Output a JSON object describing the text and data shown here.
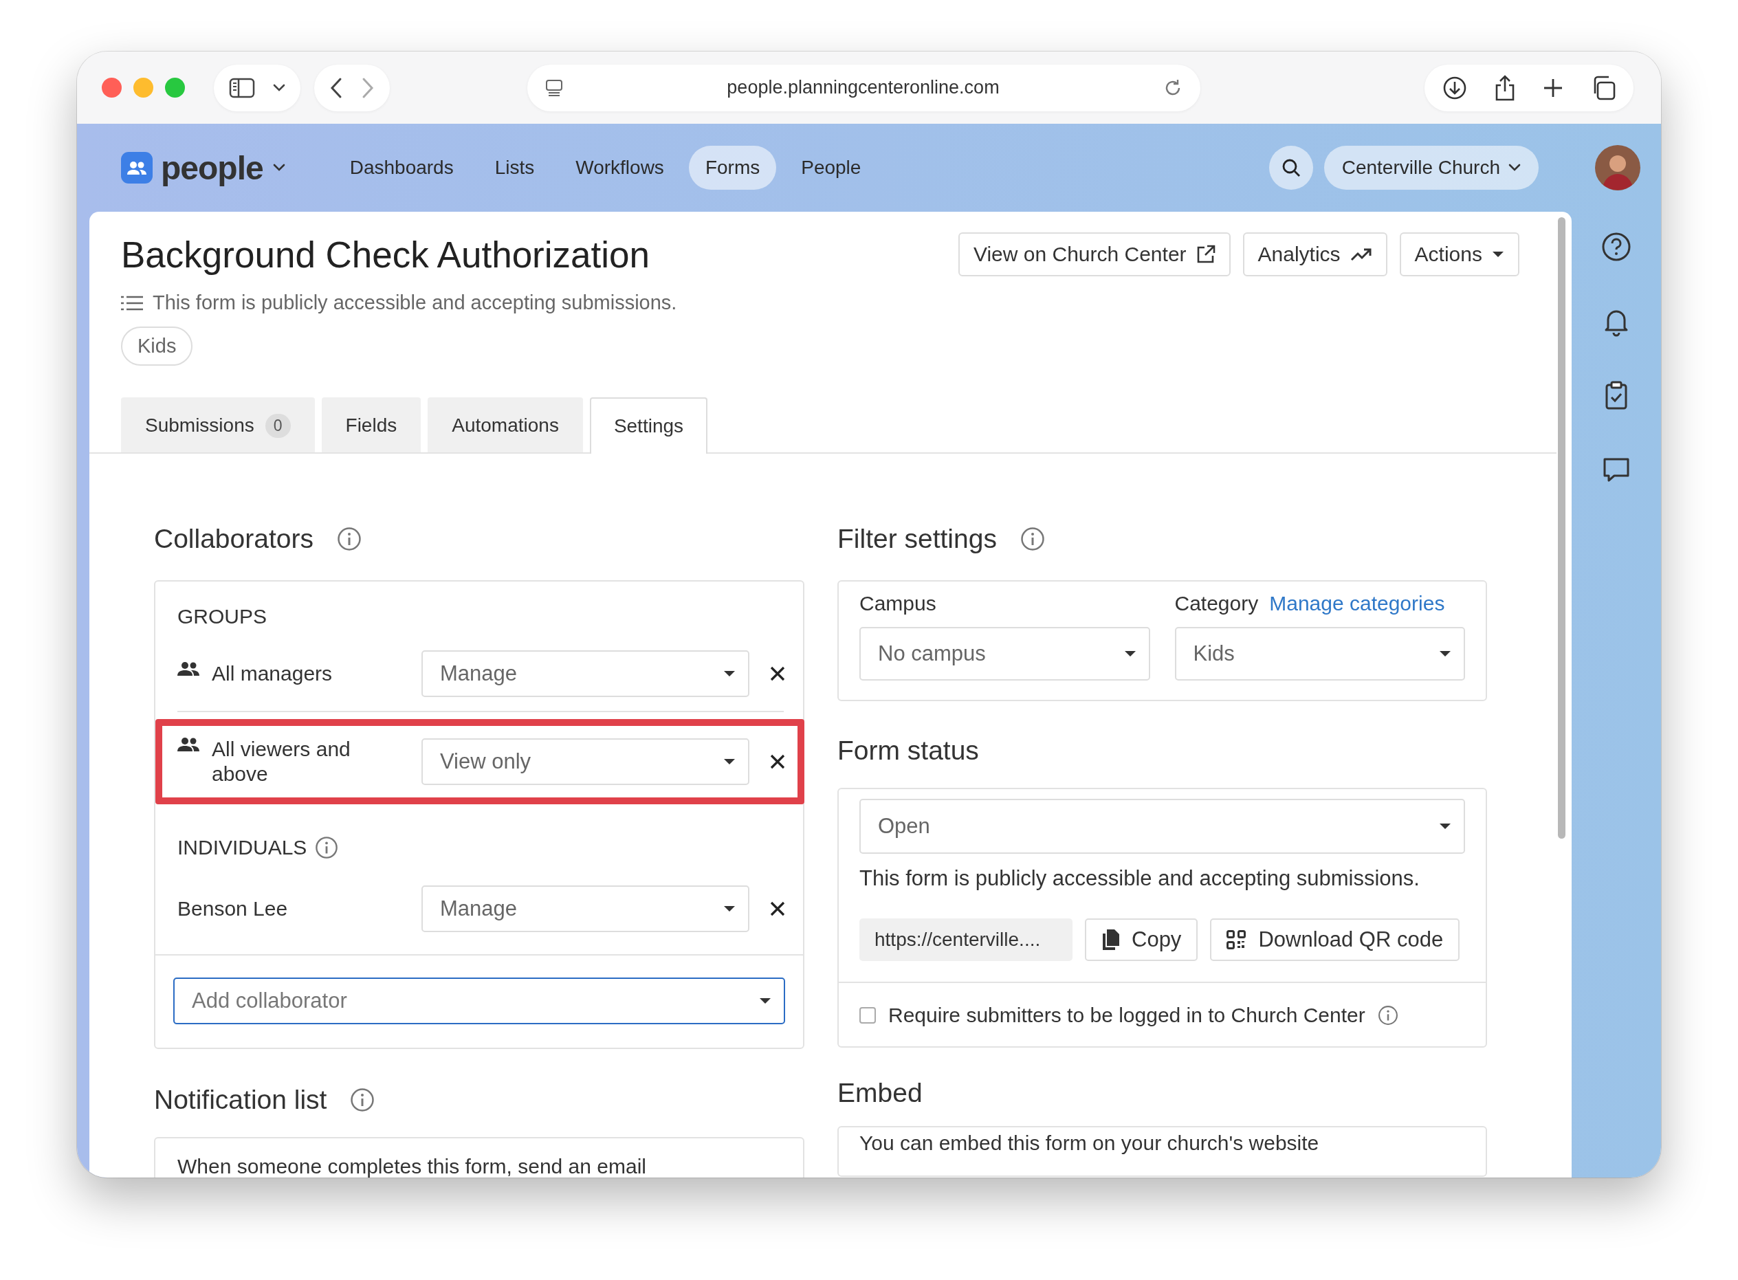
{
  "browser": {
    "url": "people.planningcenteronline.com"
  },
  "app": {
    "name": "people"
  },
  "nav": [
    {
      "label": "Dashboards",
      "selected": false
    },
    {
      "label": "Lists",
      "selected": false
    },
    {
      "label": "Workflows",
      "selected": false
    },
    {
      "label": "Forms",
      "selected": true
    },
    {
      "label": "People",
      "selected": false
    }
  ],
  "org": {
    "label": "Centerville Church"
  },
  "header": {
    "title": "Background Check Authorization",
    "status": "This form is publicly accessible and accepting submissions.",
    "tags": [
      "Kids"
    ],
    "buttons": [
      {
        "label": "View on Church Center",
        "kind": "link"
      },
      {
        "label": "Analytics",
        "kind": "report"
      },
      {
        "label": "Actions",
        "kind": "menu"
      }
    ]
  },
  "tabs": [
    {
      "label": "Submissions",
      "count": "0",
      "selected": false
    },
    {
      "label": "Fields",
      "selected": false
    },
    {
      "label": "Automations",
      "selected": false
    },
    {
      "label": "Settings",
      "selected": true
    }
  ],
  "collaborators": {
    "title": "Collaborators",
    "groups_heading": "GROUPS",
    "groups": [
      {
        "name": "All managers",
        "permission": "Manage",
        "highlighted": false
      },
      {
        "name": "All viewers and above",
        "permission": "View only",
        "highlighted": true
      }
    ],
    "individuals_heading": "INDIVIDUALS",
    "individuals": [
      {
        "name": "Benson Lee",
        "permission": "Manage"
      }
    ],
    "add": {
      "placeholder": "Add collaborator"
    }
  },
  "notification_list": {
    "title": "Notification list",
    "text": "When someone completes this form, send an email"
  },
  "filter_settings": {
    "title": "Filter settings",
    "campus": {
      "label": "Campus",
      "value": "No campus"
    },
    "category": {
      "label": "Category",
      "link": "Manage categories",
      "value": "Kids"
    }
  },
  "form_status": {
    "title": "Form status",
    "value": "Open",
    "description": "This form is publicly accessible and accepting submissions.",
    "url": "https://centerville....",
    "copy": "Copy",
    "qr": "Download QR code",
    "require_login": {
      "label": "Require submitters to be logged in to Church Center",
      "checked": false
    }
  },
  "embed": {
    "title": "Embed",
    "text": "You can embed this form on your church's website"
  }
}
